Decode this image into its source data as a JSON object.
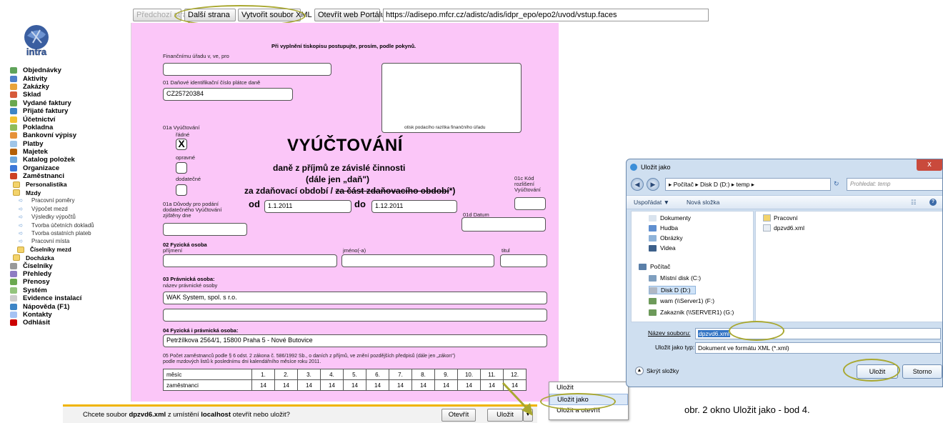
{
  "toolbar": {
    "prev_label": "Předchozí strana",
    "next_label": "Další strana",
    "xml_label": "Vytvořit soubor XML",
    "portal_label": "Otevřít web Portálu",
    "url": "https://adisepo.mfcr.cz/adistc/adis/idpr_epo/epo2/uvod/vstup.faces"
  },
  "sidebar": {
    "logo_text": "intra",
    "items": [
      {
        "label": "Objednávky",
        "level": 1,
        "color": "#5fa35a"
      },
      {
        "label": "Aktivity",
        "level": 1,
        "color": "#4f7fc9"
      },
      {
        "label": "Zakázky",
        "level": 1,
        "color": "#e8a33a"
      },
      {
        "label": "Sklad",
        "level": 1,
        "color": "#d65a3a"
      },
      {
        "label": "Vydané faktury",
        "level": 1,
        "color": "#6aa84f"
      },
      {
        "label": "Přijaté faktury",
        "level": 1,
        "color": "#3d85c6"
      },
      {
        "label": "Účetnictví",
        "level": 1,
        "color": "#f1c232"
      },
      {
        "label": "Pokladna",
        "level": 1,
        "color": "#8fbc5a"
      },
      {
        "label": "Bankovní výpisy",
        "level": 1,
        "color": "#e69138"
      },
      {
        "label": "Platby",
        "level": 1,
        "color": "#9fc5e8"
      },
      {
        "label": "Majetek",
        "level": 1,
        "color": "#b45f06"
      },
      {
        "label": "Katalog položek",
        "level": 1,
        "color": "#6fa8dc"
      },
      {
        "label": "Organizace",
        "level": 1,
        "color": "#3c78d8"
      },
      {
        "label": "Zaměstnanci",
        "level": 1,
        "color": "#cc4125"
      },
      {
        "label": "Personalistika",
        "level": 2
      },
      {
        "label": "Mzdy",
        "level": 2
      },
      {
        "label": "Pracovní poměry",
        "level": 4
      },
      {
        "label": "Výpočet mezd",
        "level": 4
      },
      {
        "label": "Výsledky výpočtů",
        "level": 4
      },
      {
        "label": "Tvorba účetních dokladů",
        "level": 4
      },
      {
        "label": "Tvorba ostatních plateb",
        "level": 4
      },
      {
        "label": "Pracovní místa",
        "level": 4
      },
      {
        "label": "Číselníky mezd",
        "level": 3
      },
      {
        "label": "Docházka",
        "level": 2
      },
      {
        "label": "Číselníky",
        "level": 1,
        "color": "#999999"
      },
      {
        "label": "Přehledy",
        "level": 1,
        "color": "#8e7cc3"
      },
      {
        "label": "Přenosy",
        "level": 1,
        "color": "#6aa84f"
      },
      {
        "label": "Systém",
        "level": 1,
        "color": "#93c47d"
      },
      {
        "label": "Evidence instalací",
        "level": 1,
        "color": "#cccccc"
      },
      {
        "label": "Nápověda (F1)",
        "level": 1,
        "color": "#3d85c6"
      },
      {
        "label": "Kontakty",
        "level": 1,
        "color": "#a4c2f4"
      },
      {
        "label": "Odhlásit",
        "level": 1,
        "color": "#cc0000"
      }
    ]
  },
  "form": {
    "instruction": "Při vyplnění tiskopisu postupujte, prosím, podle pokynů.",
    "office_label": "Finančnímu úřadu v, ve, pro",
    "office_value": "",
    "dic_label": "01 Daňové identifikační číslo plátce daně",
    "dic_value": "CZ25720384",
    "stamp_label": "otisk podacího razítka finančního úřadu",
    "vyuct_label": "01a Vyúčtování",
    "radne_label": "řádné",
    "radne_checked": "X",
    "opravne_label": "opravné",
    "dodatecne_label": "dodatečné",
    "title": "VYÚČTOVÁNÍ",
    "subtitle1": "daně z příjmů ze závislé činnosti",
    "subtitle2": "(dále jen „daň\")",
    "subtitle3_a": "za zdaňovací období / ",
    "subtitle3_b": "za část zdaňovacího období",
    "subtitle3_c": "*)",
    "kod_label": "01c Kód rozlišení Vyúčtování",
    "od_label": "od",
    "od_value": "1.1.2011",
    "do_label": "do",
    "do_value": "1.12.2011",
    "duvody_label": "01a Důvody pro podání dodatečného Vyúčtování zjištěny dne",
    "datum_label": "01d Datum",
    "fo_label": "02 Fyzická osoba",
    "prijmeni_label": "příjmení",
    "jmeno_label": "jméno(-a)",
    "titul_label": "titul",
    "po_label": "03 Právnická osoba:",
    "nazev_label": "název právnické osoby",
    "nazev_value": "WAK System, spol. s r.o.",
    "adresa_label": "04 Fyzická i právnická osoba:",
    "adresa_value": "Petržílkova 2564/1, 15800 Praha 5 - Nové Butovice",
    "pocet_label_1": "05 Počet zaměstnanců podle § 6 odst. 2 zákona č. 586/1992 Sb., o daních z příjmů, ve znění pozdějších předpisů (dále jen „zákon\")",
    "pocet_label_2": "podle mzdových listů k poslednímu dni kalendářního měsíce roku 2011.",
    "table": {
      "month_label": "měsíc",
      "employees_label": "zaměstnanci",
      "months": [
        "1.",
        "2.",
        "3.",
        "4.",
        "5.",
        "6.",
        "7.",
        "8.",
        "9.",
        "10.",
        "11.",
        "12."
      ],
      "employees": [
        "14",
        "14",
        "14",
        "14",
        "14",
        "14",
        "14",
        "14",
        "14",
        "14",
        "14",
        "14"
      ]
    }
  },
  "download_bar": {
    "msg_a": "Chcete soubor ",
    "filename": "dpzvd6.xml",
    "msg_b": " z umístění ",
    "host": "localhost",
    "msg_c": " otevřít nebo uložit?",
    "open_label": "Otevřít",
    "save_label": "Uložit",
    "menu": [
      "Uložit",
      "Uložit jako",
      "Uložit a otevřít"
    ]
  },
  "dialog": {
    "title": "Uložit jako",
    "close": "x",
    "breadcrumb": "▸ Počítač ▸ Disk D (D:) ▸ temp ▸",
    "search_placeholder": "Prohledat: temp",
    "organize": "Uspořádat ▼",
    "new_folder": "Nová složka",
    "nav_items": [
      {
        "label": "Dokumenty",
        "color": "#d9e3ee"
      },
      {
        "label": "Hudba",
        "color": "#5f8fd0"
      },
      {
        "label": "Obrázky",
        "color": "#8fb3d9"
      },
      {
        "label": "Videa",
        "color": "#3c5f8a"
      },
      {
        "label": "Počítač",
        "color": "#5a7fa8"
      },
      {
        "label": "Místní disk (C:)",
        "color": "#7f9fbf"
      },
      {
        "label": "Disk D (D:)",
        "color": "#b0b8c4"
      },
      {
        "label": "wam (\\\\Server1) (F:)",
        "color": "#6d9a5a"
      },
      {
        "label": "Zakaznik (\\\\SERVER1) (G:)",
        "color": "#6d9a5a"
      }
    ],
    "files": [
      {
        "label": "Pracovní",
        "color": "#f3d36b"
      },
      {
        "label": "dpzvd6.xml",
        "color": "#e9eef4"
      }
    ],
    "name_label": "Název souboru:",
    "name_value": "dpzvd6.xml",
    "type_label": "Uložit jako typ:",
    "type_value": "Dokument ve formátu XML (*.xml)",
    "hide_folders": "Skrýt složky",
    "save_btn": "Uložit",
    "cancel_btn": "Storno"
  },
  "caption": "obr. 2 okno Uložit jako - bod 4."
}
